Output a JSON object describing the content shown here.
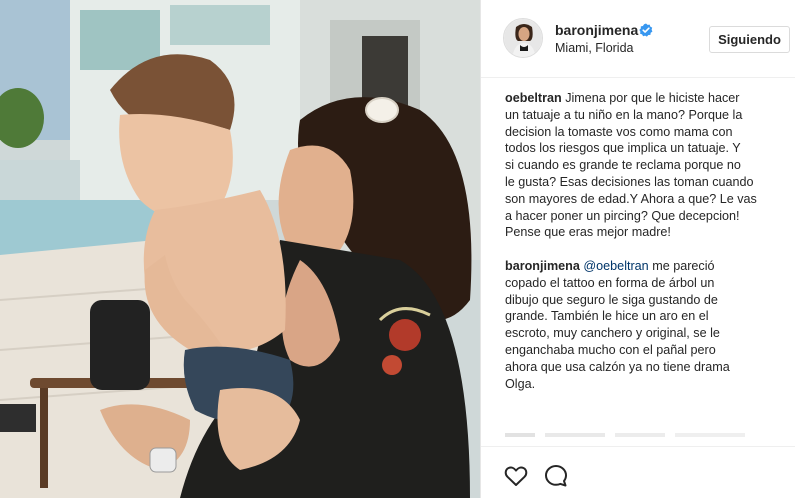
{
  "post": {
    "username": "baronjimena",
    "location": "Miami, Florida",
    "follow_label": "Siguiendo"
  },
  "comments": [
    {
      "user": "oebeltran",
      "lines": [
        "Jimena por que le hiciste hacer",
        "un tatuaje a tu niño en la mano? Porque la",
        "decision la tomaste vos como mama con",
        "todos los riesgos que implica un tatuaje. Y",
        "si cuando es grande te reclama porque no",
        "le gusta? Esas decisiones las toman cuando",
        "son mayores de edad.Y Ahora a que? Le vas",
        "a hacer poner un pircing? Que decepcion!",
        "Pense que eras mejor madre!"
      ]
    },
    {
      "user": "baronjimena",
      "mention": "@oebeltran",
      "lines": [
        "me pareció",
        "copado el tattoo en forma de árbol un",
        "dibujo que seguro le siga gustando de",
        "grande. También le hice un aro en el",
        "escroto, muy canchero y original, se le",
        "enganchaba mucho con el pañal pero",
        "ahora que usa calzón ya no tiene drama",
        "Olga."
      ]
    }
  ],
  "icons": {
    "verified": "verified-badge-icon",
    "like": "heart-icon",
    "comment": "comment-bubble-icon"
  },
  "colors": {
    "verified_blue": "#3897f0",
    "text": "#262626",
    "mention": "#003569",
    "border": "#dbdbdb"
  }
}
